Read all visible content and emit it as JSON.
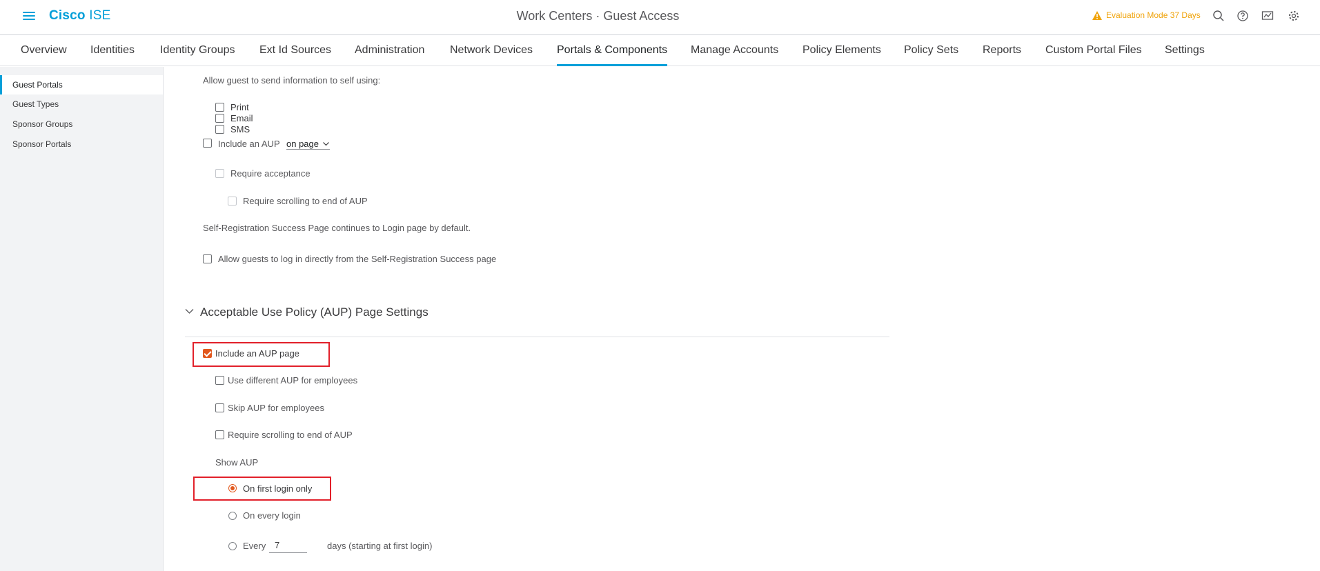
{
  "header": {
    "brand_bold": "Cisco",
    "brand_light": " ISE",
    "title": "Work Centers · Guest Access",
    "evaluation": "Evaluation Mode 37 Days",
    "icons": [
      "search-icon",
      "help-icon",
      "notifications-icon",
      "settings-icon"
    ]
  },
  "nav": {
    "tabs": [
      "Overview",
      "Identities",
      "Identity Groups",
      "Ext Id Sources",
      "Administration",
      "Network Devices",
      "Portals & Components",
      "Manage Accounts",
      "Policy Elements",
      "Policy Sets",
      "Reports",
      "Custom Portal Files",
      "Settings"
    ],
    "active": "Portals & Components"
  },
  "sidebar": {
    "items": [
      "Guest Portals",
      "Guest Types",
      "Sponsor Groups",
      "Sponsor Portals"
    ],
    "active": "Guest Portals"
  },
  "content": {
    "send_info_label": "Allow guest to send information to self using:",
    "send_options": [
      "Print",
      "Email",
      "SMS"
    ],
    "include_aup_label": "Include an AUP",
    "include_aup_mode": "on page",
    "require_acceptance": "Require acceptance",
    "require_scrolling": "Require scrolling to end of AUP",
    "success_note": "Self-Registration Success Page continues to Login page by default.",
    "allow_direct_login": "Allow guests to log in directly from the Self-Registration Success page",
    "aup_section": {
      "title": "Acceptable Use Policy (AUP) Page Settings",
      "include_aup_page": "Include an AUP page",
      "include_aup_page_checked": true,
      "different_aup": "Use different AUP for employees",
      "skip_aup": "Skip AUP for employees",
      "require_scrolling": "Require scrolling to end of AUP",
      "show_aup_label": "Show AUP",
      "options": [
        "On first login only",
        "On every login",
        "Every"
      ],
      "selected": "On first login only",
      "every_days_value": "7",
      "days_suffix": "days (starting at first login)"
    }
  },
  "colors": {
    "accent": "#049fd9",
    "checked": "#e2581d",
    "highlight": "#e2202a",
    "warning": "#f0a30a"
  }
}
